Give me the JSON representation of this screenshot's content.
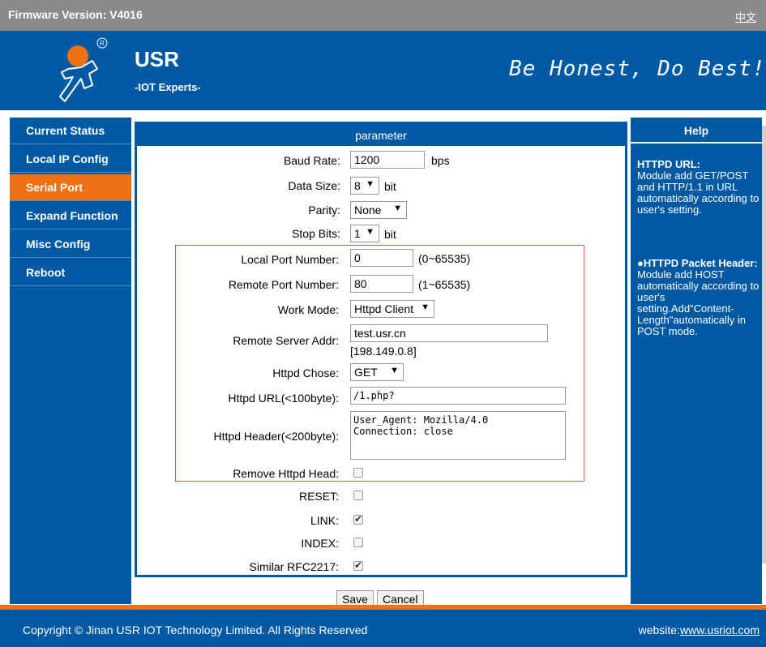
{
  "topbar": {
    "firmware": "Firmware Version: V4016",
    "lang": "中文"
  },
  "header": {
    "brand": "USR",
    "tagline": "-IOT Experts-",
    "motto": "Be Honest, Do Best!"
  },
  "nav": [
    "Current Status",
    "Local IP Config",
    "Serial Port",
    "Expand Function",
    "Misc Config",
    "Reboot"
  ],
  "panel": {
    "title": "parameter"
  },
  "form": {
    "baud": {
      "label": "Baud Rate:",
      "value": "1200",
      "unit": "bps"
    },
    "data_size": {
      "label": "Data Size:",
      "value": "8",
      "unit": "bit"
    },
    "parity": {
      "label": "Parity:",
      "value": "None"
    },
    "stop_bits": {
      "label": "Stop Bits:",
      "value": "1",
      "unit": "bit"
    },
    "local_port": {
      "label": "Local Port Number:",
      "value": "0",
      "range": "(0~65535)"
    },
    "remote_port": {
      "label": "Remote Port Number:",
      "value": "80",
      "range": "(1~65535)"
    },
    "work_mode": {
      "label": "Work Mode:",
      "value": "Httpd Client"
    },
    "remote_server": {
      "label": "Remote Server Addr:",
      "value": "test.usr.cn",
      "resolved": "[198.149.0.8]"
    },
    "httpd_chose": {
      "label": "Httpd Chose:",
      "value": "GET"
    },
    "httpd_url": {
      "label": "Httpd URL(<100byte):",
      "value": "/1.php?"
    },
    "httpd_header": {
      "label": "Httpd Header(<200byte):",
      "value": "User_Agent: Mozilla/4.0\nConnection: close"
    },
    "remove_head": {
      "label": "Remove Httpd Head:",
      "checked": false
    },
    "reset": {
      "label": "RESET:",
      "checked": false
    },
    "link": {
      "label": "LINK:",
      "checked": true
    },
    "index": {
      "label": "INDEX:",
      "checked": false
    },
    "rfc2217": {
      "label": "Similar RFC2217:",
      "checked": true
    }
  },
  "buttons": {
    "save": "Save",
    "cancel": "Cancel"
  },
  "help": {
    "title": "Help",
    "items": [
      {
        "heading": "HTTPD URL:",
        "body": "Module add GET/POST and HTTP/1.1 in URL automatically according to user's setting."
      },
      {
        "heading": "●HTTPD Packet Header:",
        "body": "Module add HOST automatically according to user's setting.Add\"Content-Length\"automatically in POST mode."
      }
    ]
  },
  "footer": {
    "copyright": "Copyright © Jinan USR IOT Technology Limited. All Rights Reserved",
    "website_label": "website:",
    "website": "www.usriot.com"
  },
  "colors": {
    "primary": "#0059a3",
    "accent": "#f07014",
    "topbar": "#8a8a8a"
  }
}
